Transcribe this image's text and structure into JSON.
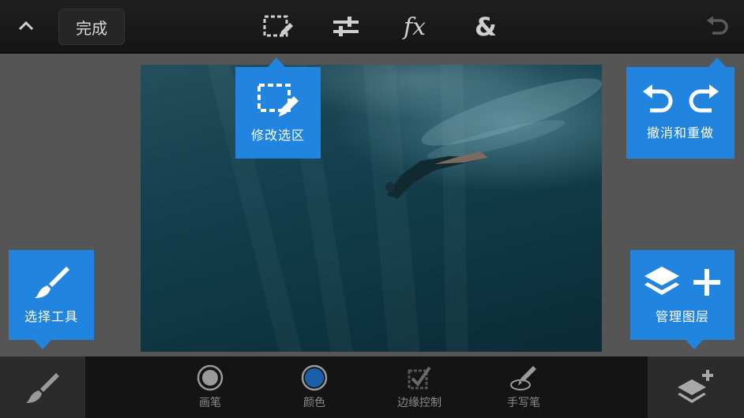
{
  "toolbar": {
    "collapse_icon": "chevron-up-icon",
    "done_label": "完成",
    "tools": [
      {
        "name": "selection-edit",
        "icon": "dashed-selection-pencil-icon"
      },
      {
        "name": "adjustments",
        "icon": "sliders-icon"
      },
      {
        "name": "effects",
        "icon": "fx-icon"
      },
      {
        "name": "combine",
        "icon": "ampersand-icon"
      }
    ],
    "fx_glyph": "fx",
    "amp_glyph": "&",
    "undo_icon": "undo-icon"
  },
  "callouts": {
    "modify_selection": "修改选区",
    "undo_redo": "撤消和重做",
    "select_tool": "选择工具",
    "manage_layers": "管理图层"
  },
  "bottom": {
    "brush_tool_icon": "brush-icon",
    "tools": [
      {
        "label": "画笔",
        "icon": "brush-circle-icon"
      },
      {
        "label": "颜色",
        "icon": "color-swatch-icon"
      },
      {
        "label": "边缘控制",
        "icon": "edge-checkbox-icon"
      },
      {
        "label": "手写笔",
        "icon": "stylus-icon"
      }
    ],
    "layers_icon": "layers-add-icon"
  },
  "colors": {
    "accent": "#2184de",
    "toolbar_bg": "#1b1b1b",
    "canvas_bg": "#555555",
    "color_swatch": "#1b5fa8"
  }
}
